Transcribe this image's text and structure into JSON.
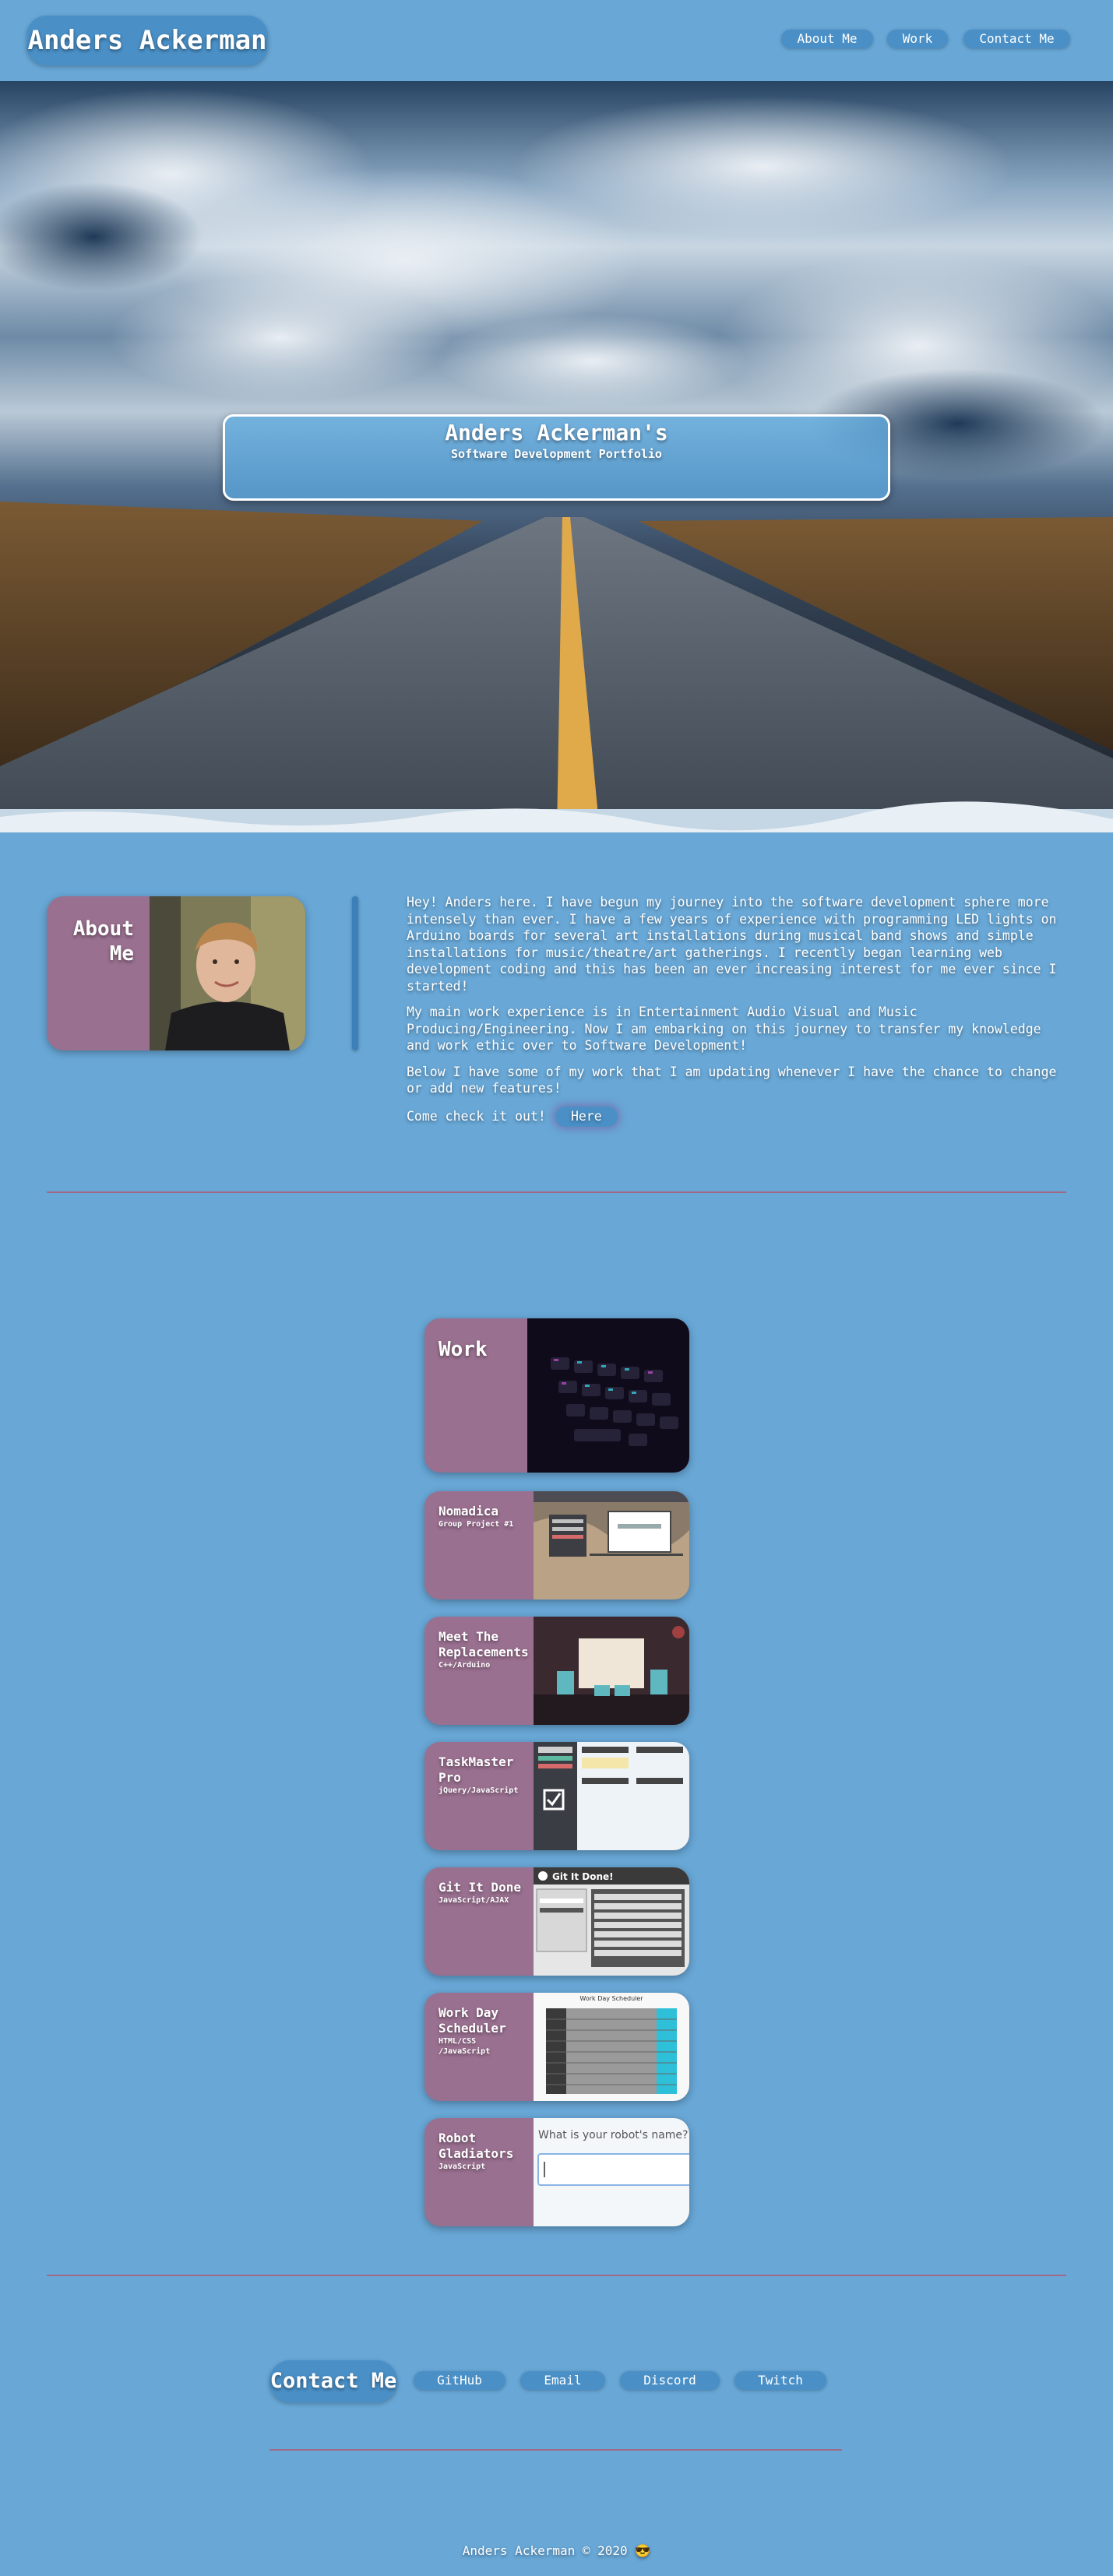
{
  "header": {
    "brand": "Anders Ackerman",
    "nav": [
      {
        "label": "About Me"
      },
      {
        "label": "Work"
      },
      {
        "label": "Contact Me"
      }
    ]
  },
  "hero": {
    "title": "Anders Ackerman's",
    "subtitle": "Software Development Portfolio"
  },
  "about": {
    "label": "About Me",
    "paragraphs": [
      "Hey! Anders here. I have begun my journey into the software development sphere more intensely than ever. I have a few years of experience with programming LED lights on Arduino boards for several art installations during musical band shows and simple installations for music/theatre/art gatherings. I recently began learning web development coding and this has been an ever increasing interest for me ever since I started!",
      "My main work experience is in Entertainment Audio Visual and Music Producing/Engineering. Now I am embarking on this journey to transfer my knowledge and work ethic over to Software Development!",
      "Below I have some of my work that I am updating whenever I have the chance to change or add new features!"
    ],
    "cta_text": "Come check it out!",
    "cta_button": "Here"
  },
  "work": {
    "label": "Work",
    "projects": [
      {
        "title": "Nomadica",
        "subtitle": "Group Project #1"
      },
      {
        "title": "Meet The Replacements",
        "subtitle": "C++/Arduino"
      },
      {
        "title": "TaskMaster Pro",
        "subtitle": "jQuery/JavaScript"
      },
      {
        "title": "Git It Done",
        "subtitle": "JavaScript/AJAX"
      },
      {
        "title": "Work Day Scheduler",
        "subtitle": "HTML/CSS /JavaScript"
      },
      {
        "title": "Robot Gladiators",
        "subtitle": "JavaScript"
      }
    ],
    "screenshots": {
      "git_it_done_heading": "Git It Done!",
      "scheduler_heading": "Work Day Scheduler",
      "robot_prompt": "What is your robot's name?"
    }
  },
  "contact": {
    "title": "Contact Me",
    "links": [
      {
        "label": "GitHub"
      },
      {
        "label": "Email"
      },
      {
        "label": "Discord"
      },
      {
        "label": "Twitch"
      }
    ]
  },
  "footer": {
    "text": "Anders Ackerman © 2020 😎"
  },
  "colors": {
    "background": "#68a7d6",
    "pill": "#4a90c7",
    "card": "#9a7090",
    "divider": "#a06a86"
  }
}
